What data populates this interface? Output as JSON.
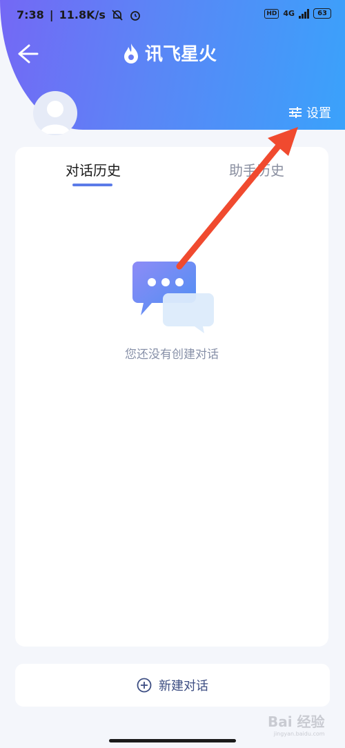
{
  "status_bar": {
    "time": "7:38",
    "speed": "11.8K/s",
    "hd": "HD",
    "network": "4G",
    "battery": "63"
  },
  "header": {
    "brand": "讯飞星火",
    "settings_label": "设置"
  },
  "tabs": [
    {
      "label": "对话历史",
      "active": true
    },
    {
      "label": "助手历史",
      "active": false
    }
  ],
  "empty_state": {
    "message": "您还没有创建对话"
  },
  "new_chat": {
    "label": "新建对话"
  },
  "watermark": {
    "text": "Bai 经验",
    "sub": "jingyan.baidu.com"
  },
  "colors": {
    "header_start": "#7468f5",
    "header_end": "#3aa2fb",
    "accent": "#5b7be8",
    "annotation_arrow": "#f04a2f"
  }
}
